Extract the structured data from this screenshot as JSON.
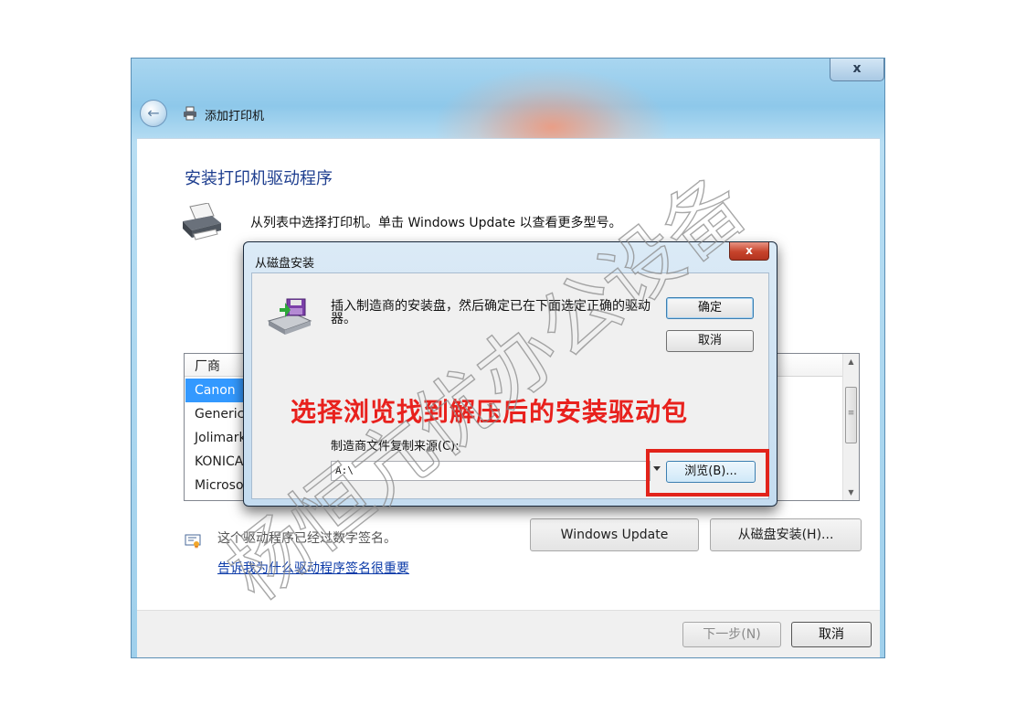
{
  "window": {
    "close_label": "x",
    "title": "添加打印机",
    "heading": "安装打印机驱动程序",
    "instruction": "从列表中选择打印机。单击 Windows Update 以查看更多型号。",
    "list_header": "厂商",
    "manufacturers": [
      "Canon",
      "Generic",
      "Jolimark",
      "KONICA",
      "Microsoft"
    ],
    "signature_text": "这个驱动程序已经过数字签名。",
    "signature_link": "告诉我为什么驱动程序签名很重要",
    "windows_update_button": "Windows Update",
    "have_disk_button": "从磁盘安装(H)...",
    "next_button": "下一步(N)",
    "cancel_button": "取消"
  },
  "dialog": {
    "title": "从磁盘安装",
    "close_label": "x",
    "message": "插入制造商的安装盘，然后确定已在下面选定正确的驱动器。",
    "ok_button": "确定",
    "cancel_button": "取消",
    "source_label": "制造商文件复制来源(C):",
    "source_value": "A:\\",
    "browse_button": "浏览(B)..."
  },
  "annotation": {
    "text": "选择浏览找到解压后的安装驱动包",
    "color": "#e8211d"
  },
  "watermark": {
    "text": "杨恒亢优办公设备"
  },
  "icons": [
    "back-arrow-icon",
    "printer-icon",
    "disk-icon",
    "certificate-icon",
    "dropdown-arrow-icon"
  ]
}
